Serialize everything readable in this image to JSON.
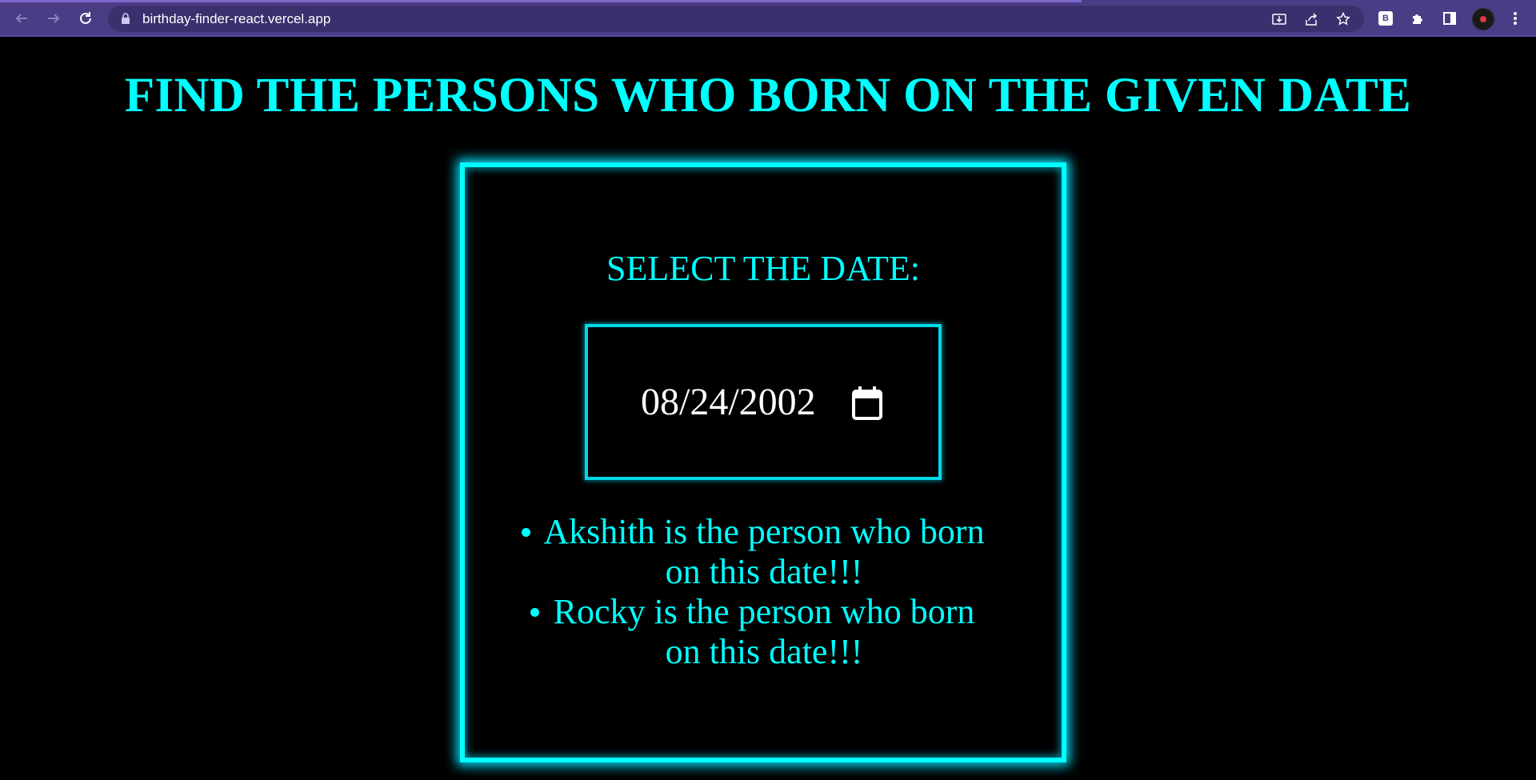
{
  "browser": {
    "url": "birthday-finder-react.vercel.app",
    "extension_badge": "B",
    "icons": {
      "back": "back-arrow-icon",
      "forward": "forward-arrow-icon",
      "reload": "reload-icon",
      "lock": "lock-icon",
      "install": "install-icon",
      "share": "share-icon",
      "bookmark": "star-icon",
      "extensions": "puzzle-icon",
      "side_panel": "side-panel-icon",
      "profile": "avatar-icon",
      "menu": "kebab-menu-icon"
    }
  },
  "page": {
    "heading": "FIND THE PERSONS WHO BORN ON THE GIVEN DATE",
    "date_label": "SELECT THE DATE:",
    "date_value": "08/24/2002",
    "results": [
      {
        "line1": "Akshith is the person who born",
        "line2": "on this date!!!"
      },
      {
        "line1": "Rocky is the person who born",
        "line2": "on this date!!!"
      }
    ]
  },
  "colors": {
    "background": "#000000",
    "accent": "#00ffff",
    "browser_bar": "#4a3c85",
    "text": "#ffffff"
  }
}
